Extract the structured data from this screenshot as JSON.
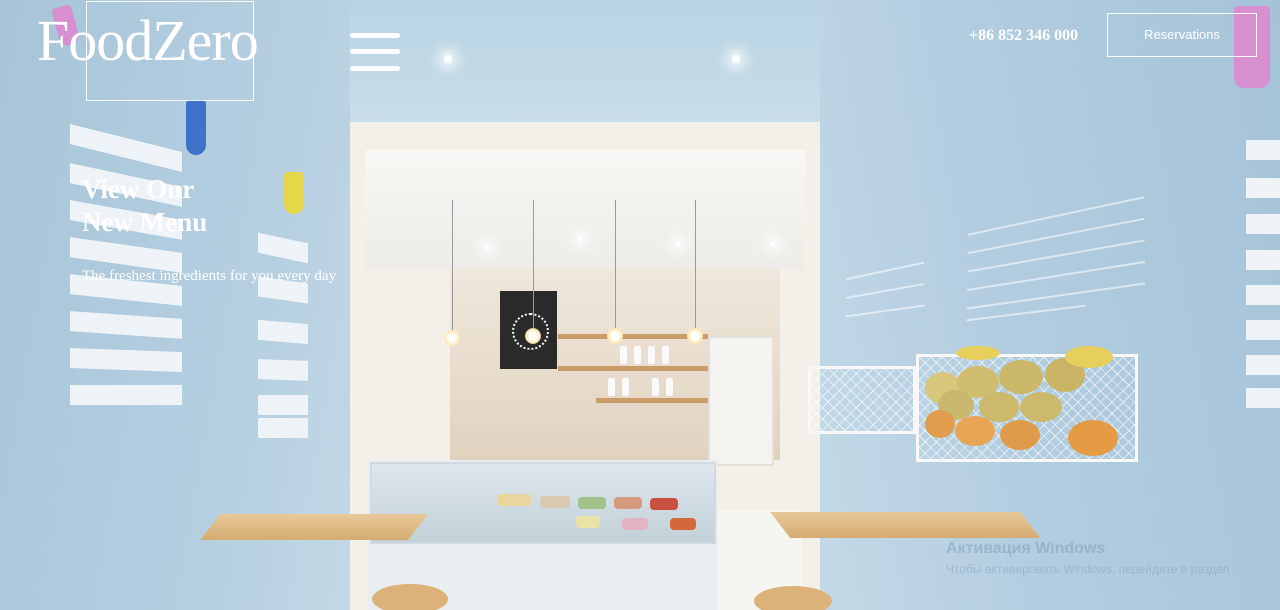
{
  "header": {
    "logo": "FoodZero",
    "phone": "+86 852 346 000",
    "reservations_label": "Reservations"
  },
  "hero": {
    "title_line1": "View Our",
    "title_line2": "New Menu",
    "subtitle": "The freshest ingredients for you every day"
  },
  "icons": {
    "menu": "hamburger-menu-icon"
  },
  "colors": {
    "text": "#ffffff",
    "wall": "#a9c6db",
    "wood": "#d9b27c"
  }
}
